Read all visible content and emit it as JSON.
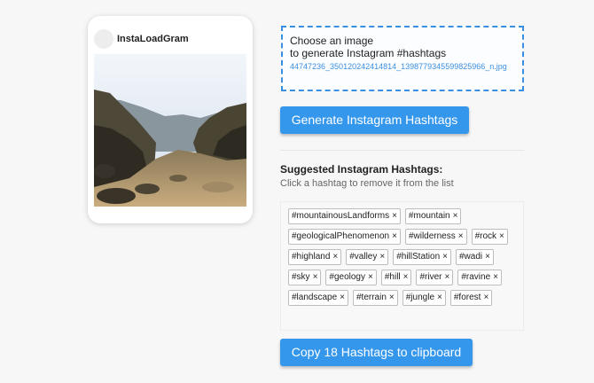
{
  "preview": {
    "username": "InstaLoadGram"
  },
  "picker": {
    "line1": "Choose an image",
    "line2": "to generate Instagram #hashtags",
    "filename": "44747236_350120242414814_1398779345599825966_n.jpg"
  },
  "buttons": {
    "generate": "Generate Instagram Hashtags",
    "copy": "Copy 18 Hashtags to clipboard"
  },
  "suggestions": {
    "title": "Suggested Instagram Hashtags:",
    "subtitle": "Click a hashtag to remove it from the list",
    "remove_glyph": "×",
    "tags": [
      "#mountainousLandforms",
      "#mountain",
      "#geologicalPhenomenon",
      "#wilderness",
      "#rock",
      "#highland",
      "#valley",
      "#hillStation",
      "#wadi",
      "#sky",
      "#geology",
      "#hill",
      "#river",
      "#ravine",
      "#landscape",
      "#terrain",
      "#jungle",
      "#forest"
    ]
  },
  "colors": {
    "accent": "#3597ec",
    "link": "#3b8fe0",
    "background": "#f7f7f7"
  }
}
